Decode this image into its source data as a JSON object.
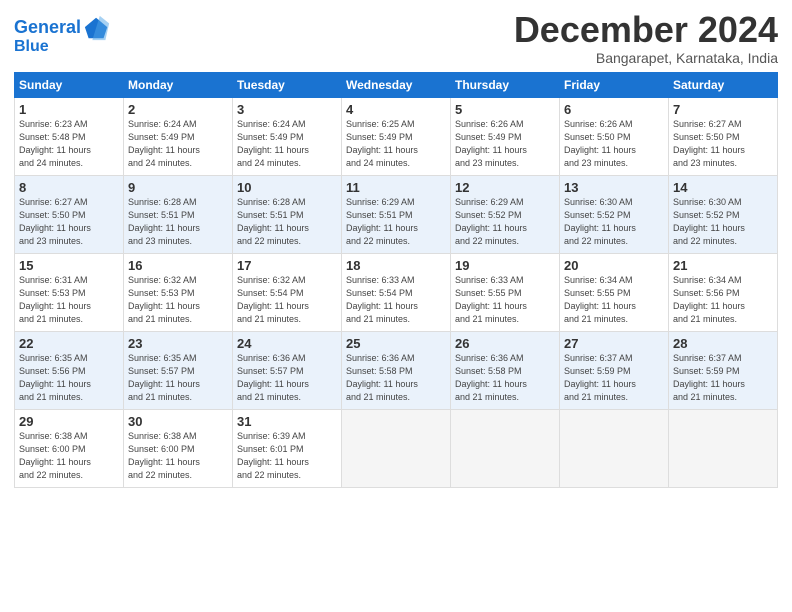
{
  "header": {
    "logo_line1": "General",
    "logo_line2": "Blue",
    "month": "December 2024",
    "location": "Bangarapet, Karnataka, India"
  },
  "days_of_week": [
    "Sunday",
    "Monday",
    "Tuesday",
    "Wednesday",
    "Thursday",
    "Friday",
    "Saturday"
  ],
  "weeks": [
    [
      {
        "num": "1",
        "info": "Sunrise: 6:23 AM\nSunset: 5:48 PM\nDaylight: 11 hours\nand 24 minutes."
      },
      {
        "num": "2",
        "info": "Sunrise: 6:24 AM\nSunset: 5:49 PM\nDaylight: 11 hours\nand 24 minutes."
      },
      {
        "num": "3",
        "info": "Sunrise: 6:24 AM\nSunset: 5:49 PM\nDaylight: 11 hours\nand 24 minutes."
      },
      {
        "num": "4",
        "info": "Sunrise: 6:25 AM\nSunset: 5:49 PM\nDaylight: 11 hours\nand 24 minutes."
      },
      {
        "num": "5",
        "info": "Sunrise: 6:26 AM\nSunset: 5:49 PM\nDaylight: 11 hours\nand 23 minutes."
      },
      {
        "num": "6",
        "info": "Sunrise: 6:26 AM\nSunset: 5:50 PM\nDaylight: 11 hours\nand 23 minutes."
      },
      {
        "num": "7",
        "info": "Sunrise: 6:27 AM\nSunset: 5:50 PM\nDaylight: 11 hours\nand 23 minutes."
      }
    ],
    [
      {
        "num": "8",
        "info": "Sunrise: 6:27 AM\nSunset: 5:50 PM\nDaylight: 11 hours\nand 23 minutes."
      },
      {
        "num": "9",
        "info": "Sunrise: 6:28 AM\nSunset: 5:51 PM\nDaylight: 11 hours\nand 23 minutes."
      },
      {
        "num": "10",
        "info": "Sunrise: 6:28 AM\nSunset: 5:51 PM\nDaylight: 11 hours\nand 22 minutes."
      },
      {
        "num": "11",
        "info": "Sunrise: 6:29 AM\nSunset: 5:51 PM\nDaylight: 11 hours\nand 22 minutes."
      },
      {
        "num": "12",
        "info": "Sunrise: 6:29 AM\nSunset: 5:52 PM\nDaylight: 11 hours\nand 22 minutes."
      },
      {
        "num": "13",
        "info": "Sunrise: 6:30 AM\nSunset: 5:52 PM\nDaylight: 11 hours\nand 22 minutes."
      },
      {
        "num": "14",
        "info": "Sunrise: 6:30 AM\nSunset: 5:52 PM\nDaylight: 11 hours\nand 22 minutes."
      }
    ],
    [
      {
        "num": "15",
        "info": "Sunrise: 6:31 AM\nSunset: 5:53 PM\nDaylight: 11 hours\nand 21 minutes."
      },
      {
        "num": "16",
        "info": "Sunrise: 6:32 AM\nSunset: 5:53 PM\nDaylight: 11 hours\nand 21 minutes."
      },
      {
        "num": "17",
        "info": "Sunrise: 6:32 AM\nSunset: 5:54 PM\nDaylight: 11 hours\nand 21 minutes."
      },
      {
        "num": "18",
        "info": "Sunrise: 6:33 AM\nSunset: 5:54 PM\nDaylight: 11 hours\nand 21 minutes."
      },
      {
        "num": "19",
        "info": "Sunrise: 6:33 AM\nSunset: 5:55 PM\nDaylight: 11 hours\nand 21 minutes."
      },
      {
        "num": "20",
        "info": "Sunrise: 6:34 AM\nSunset: 5:55 PM\nDaylight: 11 hours\nand 21 minutes."
      },
      {
        "num": "21",
        "info": "Sunrise: 6:34 AM\nSunset: 5:56 PM\nDaylight: 11 hours\nand 21 minutes."
      }
    ],
    [
      {
        "num": "22",
        "info": "Sunrise: 6:35 AM\nSunset: 5:56 PM\nDaylight: 11 hours\nand 21 minutes."
      },
      {
        "num": "23",
        "info": "Sunrise: 6:35 AM\nSunset: 5:57 PM\nDaylight: 11 hours\nand 21 minutes."
      },
      {
        "num": "24",
        "info": "Sunrise: 6:36 AM\nSunset: 5:57 PM\nDaylight: 11 hours\nand 21 minutes."
      },
      {
        "num": "25",
        "info": "Sunrise: 6:36 AM\nSunset: 5:58 PM\nDaylight: 11 hours\nand 21 minutes."
      },
      {
        "num": "26",
        "info": "Sunrise: 6:36 AM\nSunset: 5:58 PM\nDaylight: 11 hours\nand 21 minutes."
      },
      {
        "num": "27",
        "info": "Sunrise: 6:37 AM\nSunset: 5:59 PM\nDaylight: 11 hours\nand 21 minutes."
      },
      {
        "num": "28",
        "info": "Sunrise: 6:37 AM\nSunset: 5:59 PM\nDaylight: 11 hours\nand 21 minutes."
      }
    ],
    [
      {
        "num": "29",
        "info": "Sunrise: 6:38 AM\nSunset: 6:00 PM\nDaylight: 11 hours\nand 22 minutes."
      },
      {
        "num": "30",
        "info": "Sunrise: 6:38 AM\nSunset: 6:00 PM\nDaylight: 11 hours\nand 22 minutes."
      },
      {
        "num": "31",
        "info": "Sunrise: 6:39 AM\nSunset: 6:01 PM\nDaylight: 11 hours\nand 22 minutes."
      },
      {
        "num": "",
        "info": ""
      },
      {
        "num": "",
        "info": ""
      },
      {
        "num": "",
        "info": ""
      },
      {
        "num": "",
        "info": ""
      }
    ]
  ]
}
